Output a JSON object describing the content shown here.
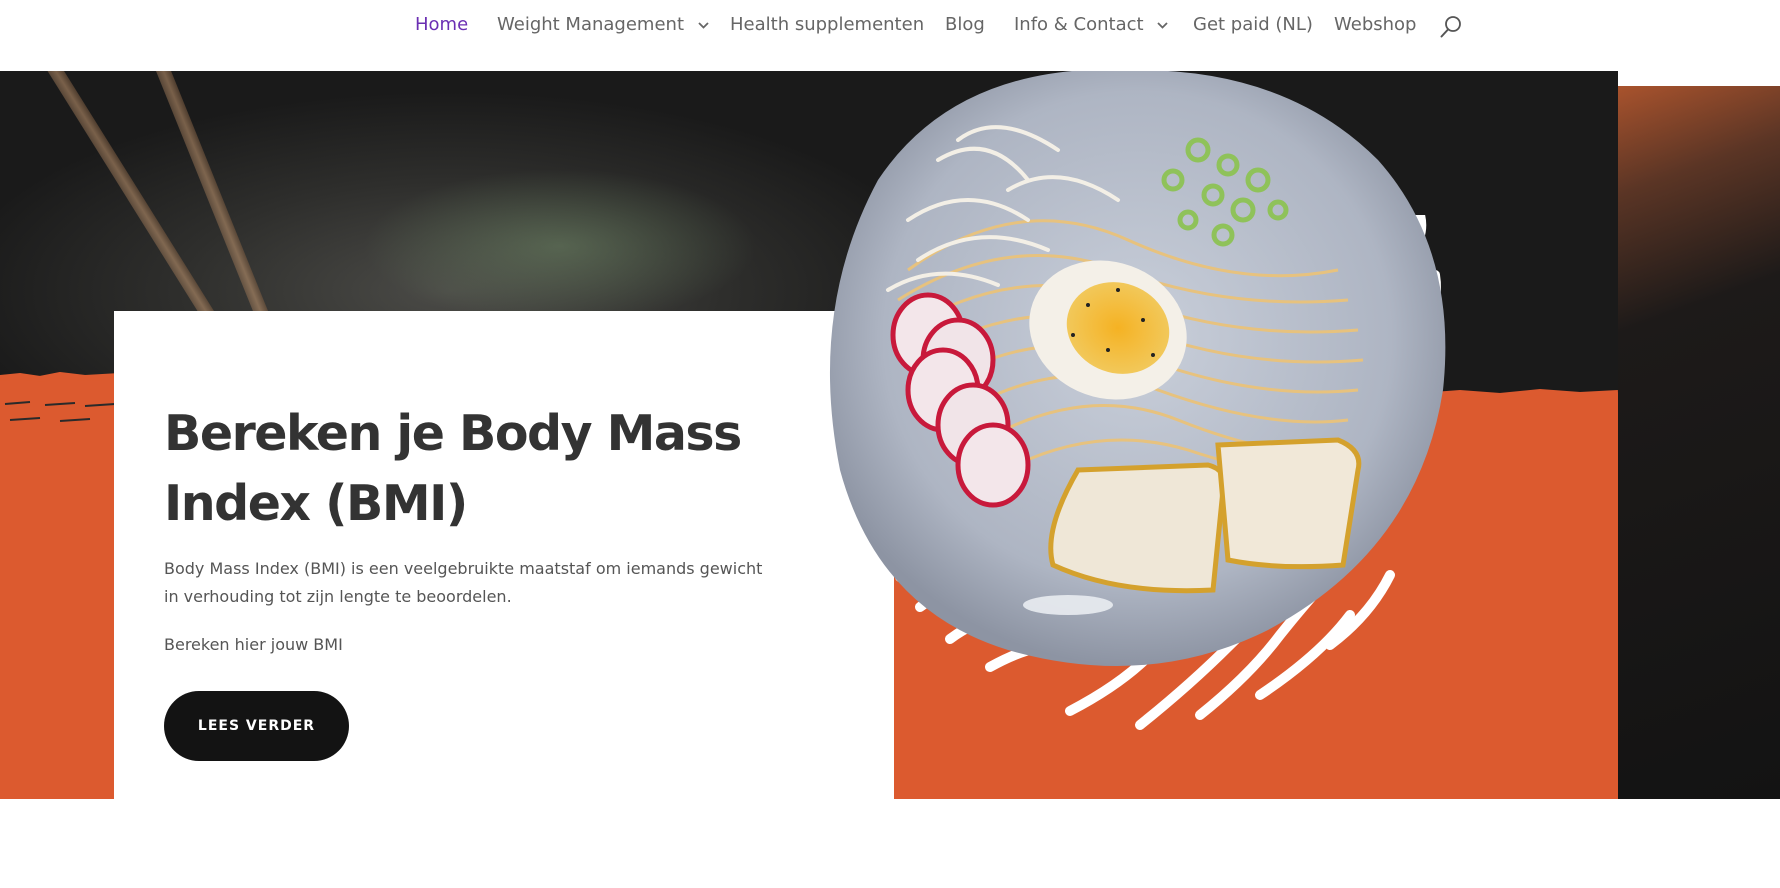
{
  "nav": {
    "items": [
      {
        "label": "Home",
        "active": true,
        "has_dropdown": false
      },
      {
        "label": "Weight Management",
        "active": false,
        "has_dropdown": true
      },
      {
        "label": "Health supplementen",
        "active": false,
        "has_dropdown": false
      },
      {
        "label": "Blog",
        "active": false,
        "has_dropdown": false
      },
      {
        "label": "Info & Contact",
        "active": false,
        "has_dropdown": true
      },
      {
        "label": "Get paid (NL)",
        "active": false,
        "has_dropdown": false
      },
      {
        "label": "Webshop",
        "active": false,
        "has_dropdown": false
      }
    ],
    "search_icon": "search-icon",
    "dropdown_icon": "chevron-down-icon"
  },
  "hero": {
    "title": "Bereken je Body Mass Index (BMI)",
    "description": "Body Mass Index (BMI) is een veelgebruikte maatstaf om iemands gewicht in verhouding tot zijn lengte te beoordelen.",
    "subtext": "Bereken hier jouw BMI",
    "cta_label": "LEES VERDER",
    "image": "ramen-bowl"
  },
  "colors": {
    "accent_orange": "#dc5a2f",
    "nav_active": "#6b2fb3",
    "nav_text": "#666666",
    "heading": "#333333",
    "body_text": "#555555",
    "button_bg": "#131313",
    "button_text": "#ffffff",
    "dark_bg": "#1a1a1a"
  }
}
